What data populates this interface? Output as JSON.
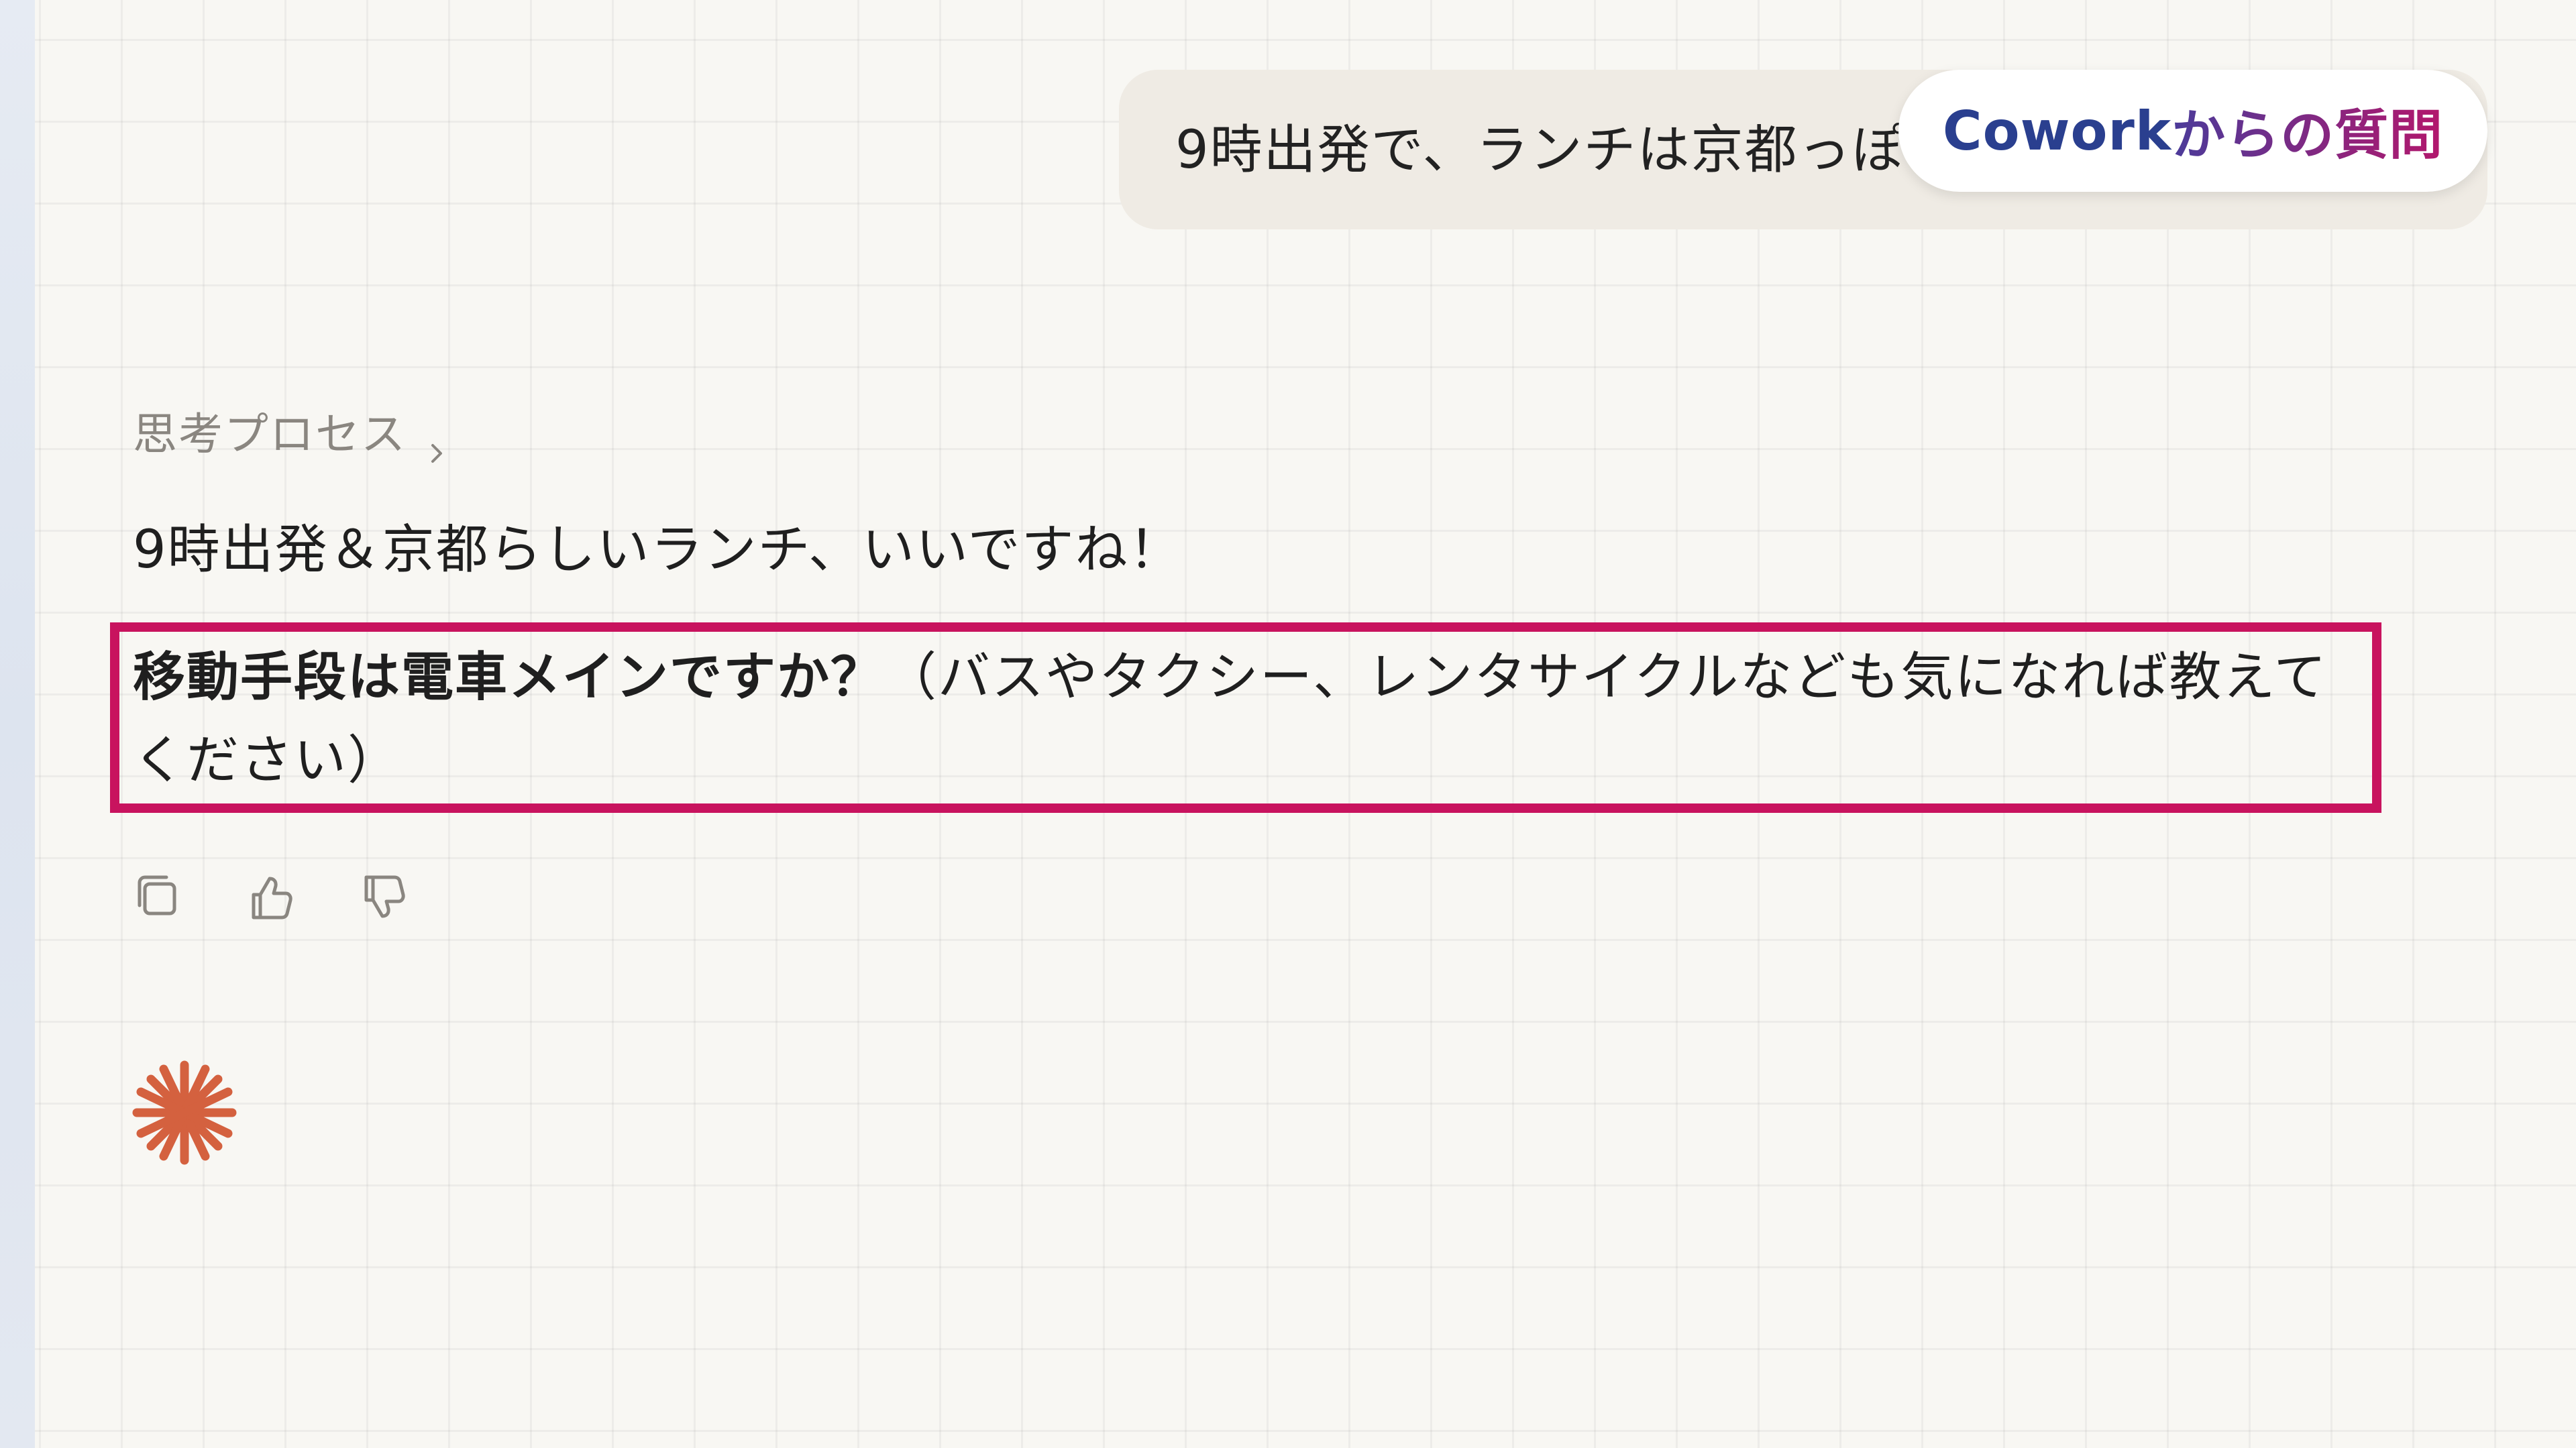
{
  "conversation": {
    "user_message": "9時出発で、ランチは京都っぽ",
    "badge": {
      "brand": "Cowork",
      "rest": "からの質問"
    },
    "thinking_label": "思考プロセス",
    "answer_line": "9時出発＆京都らしいランチ、いいですね！",
    "question_bold": "移動手段は電車メインですか？",
    "question_rest": "（バスやタクシー、レンタサイクルなども気になれば教えてください）"
  },
  "actions": {
    "copy_icon": "copy-icon",
    "thumbs_up_icon": "thumbs-up-icon",
    "thumbs_down_icon": "thumbs-down-icon"
  },
  "colors": {
    "highlight_border": "#c8135e",
    "brand_blue": "#2a3f8f",
    "spark": "#d4613f",
    "muted_text": "#8a8680"
  }
}
